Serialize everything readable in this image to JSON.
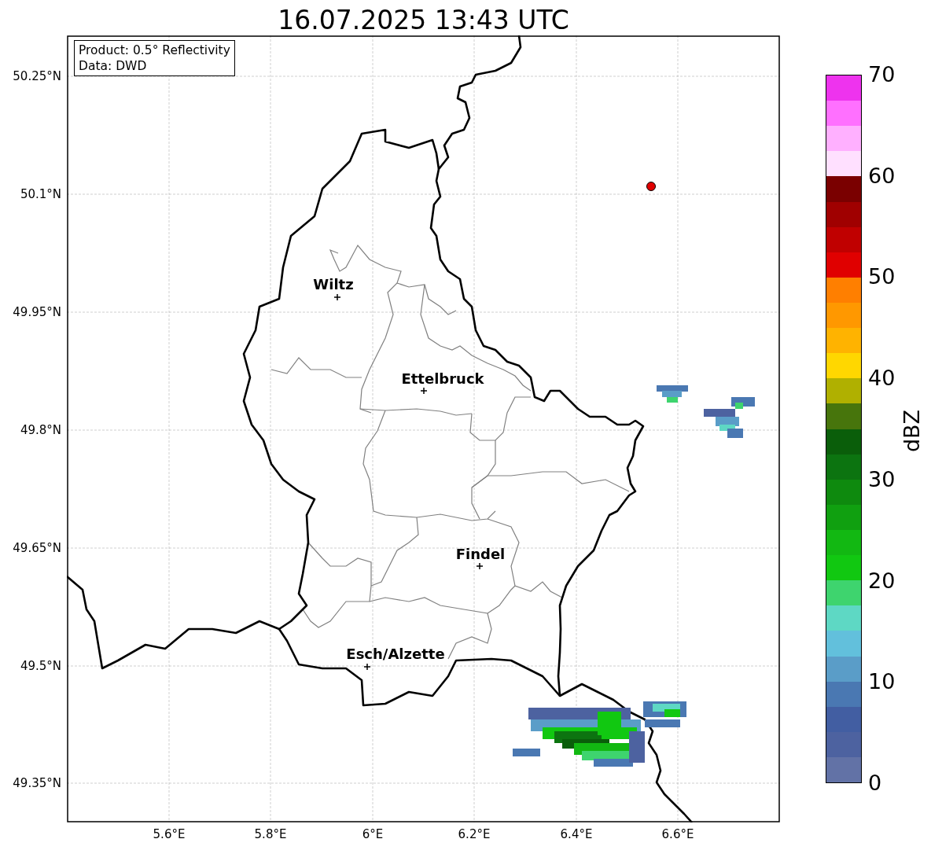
{
  "title": "16.07.2025 13:43 UTC",
  "info_box": [
    "Product: 0.5° Reflectivity",
    "Data: DWD"
  ],
  "cities": [
    {
      "name": "Wiltz"
    },
    {
      "name": "Ettelbruck"
    },
    {
      "name": "Findel"
    },
    {
      "name": "Esch/Alzette"
    }
  ],
  "x_ticks": [
    "5.6°E",
    "5.8°E",
    "6°E",
    "6.2°E",
    "6.4°E",
    "6.6°E"
  ],
  "y_ticks": [
    "50.25°N",
    "50.1°N",
    "49.95°N",
    "49.8°N",
    "49.65°N",
    "49.5°N",
    "49.35°N"
  ],
  "colorbar": {
    "label": "dBZ",
    "ticks": [
      "70",
      "60",
      "50",
      "40",
      "30",
      "20",
      "10",
      "0"
    ],
    "bins": [
      {
        "color": "#ee33ee"
      },
      {
        "color": "#ff70ff"
      },
      {
        "color": "#ffb0ff"
      },
      {
        "color": "#ffe0ff"
      },
      {
        "color": "#7a0000"
      },
      {
        "color": "#a00000"
      },
      {
        "color": "#c00000"
      },
      {
        "color": "#e00000"
      },
      {
        "color": "#ff7f00"
      },
      {
        "color": "#ff9800"
      },
      {
        "color": "#ffb300"
      },
      {
        "color": "#ffd700"
      },
      {
        "color": "#b0b000"
      },
      {
        "color": "#47750c"
      },
      {
        "color": "#0a5e0a"
      },
      {
        "color": "#0c7410"
      },
      {
        "color": "#0e8a0e"
      },
      {
        "color": "#10a010"
      },
      {
        "color": "#12b812"
      },
      {
        "color": "#11c811"
      },
      {
        "color": "#3ed46e"
      },
      {
        "color": "#5ed8c4"
      },
      {
        "color": "#62c0dc"
      },
      {
        "color": "#5a9dc8"
      },
      {
        "color": "#4a78b2"
      },
      {
        "color": "#425ea2"
      },
      {
        "color": "#4d62a0"
      },
      {
        "color": "#6272a6"
      }
    ]
  }
}
